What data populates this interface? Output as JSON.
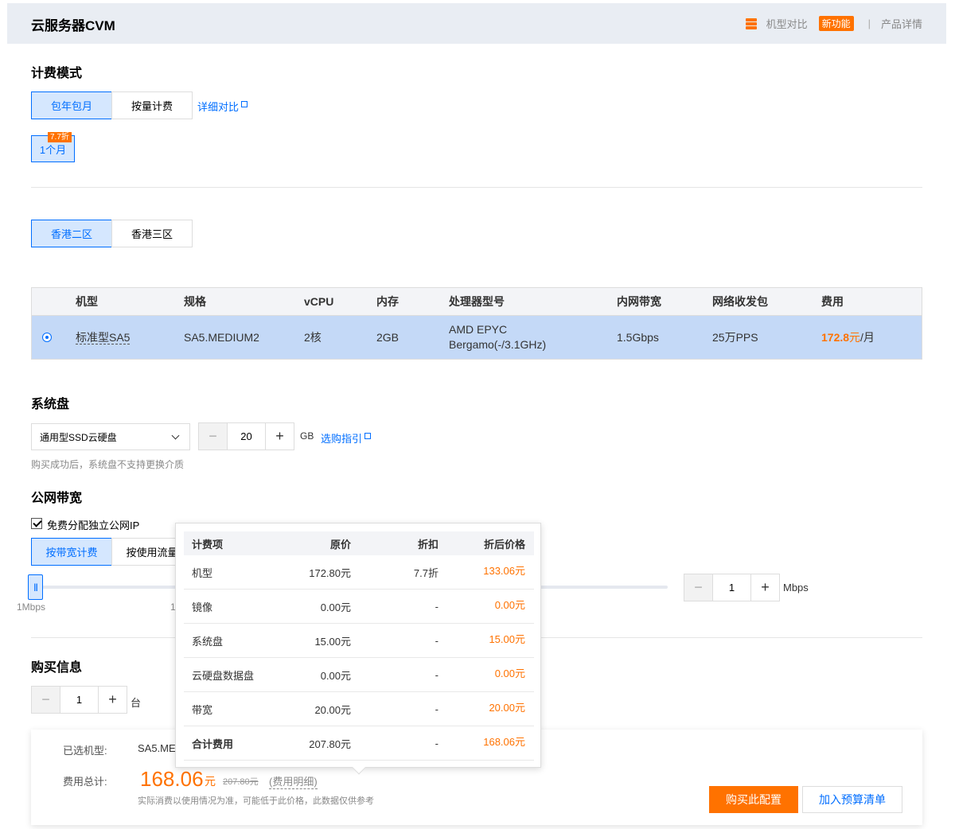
{
  "header": {
    "title": "云服务器CVM",
    "compare_label": "机型对比",
    "new_badge": "新功能",
    "separator": "|",
    "product_detail": "产品详情"
  },
  "billing": {
    "title": "计费模式",
    "options": [
      "包年包月",
      "按量计费"
    ],
    "selected": 0,
    "detail_link": "详细对比",
    "duration_discount": "7.7折",
    "duration": "1个月"
  },
  "zone": {
    "options": [
      "香港二区",
      "香港三区"
    ],
    "selected": 0
  },
  "instance_table": {
    "headers": [
      "机型",
      "规格",
      "vCPU",
      "内存",
      "处理器型号",
      "内网带宽",
      "网络收发包",
      "费用"
    ],
    "row": {
      "type": "标准型SA5",
      "spec": "SA5.MEDIUM2",
      "vcpu": "2核",
      "memory": "2GB",
      "cpu_model_line1": "AMD EPYC",
      "cpu_model_line2": "Bergamo(-/3.1GHz)",
      "bandwidth": "1.5Gbps",
      "pps": "25万PPS",
      "price": "172.8",
      "price_unit": "元",
      "price_period": "/月"
    }
  },
  "system_disk": {
    "title": "系统盘",
    "disk_type": "通用型SSD云硬盘",
    "size": "20",
    "unit": "GB",
    "guide_link": "选购指引",
    "hint": "购买成功后，系统盘不支持更换介质"
  },
  "network": {
    "title": "公网带宽",
    "free_ip_label": "免费分配独立公网IP",
    "billing_options": [
      "按带宽计费",
      "按使用流量"
    ],
    "selected": 0,
    "slider_min_label": "1Mbps",
    "slider_tick_label": "1",
    "bandwidth_value": "1",
    "bandwidth_unit": "Mbps"
  },
  "purchase": {
    "title": "购买信息",
    "quantity": "1",
    "quantity_unit": "台"
  },
  "footer": {
    "selected_label": "已选机型:",
    "selected_value": "SA5.ME",
    "total_label": "费用总计:",
    "total_price": "168.06",
    "total_unit": "元",
    "original_price": "207.80元",
    "detail_link": "(费用明细)",
    "note": "实际消费以使用情况为准，可能低于此价格，此数据仅供参考",
    "buy_button": "购买此配置",
    "budget_button": "加入预算清单"
  },
  "price_popover": {
    "headers": [
      "计费项",
      "原价",
      "折扣",
      "折后价格"
    ],
    "rows": [
      {
        "item": "机型",
        "original": "172.80元",
        "discount": "7.7折",
        "final": "133.06元"
      },
      {
        "item": "镜像",
        "original": "0.00元",
        "discount": "-",
        "final": "0.00元"
      },
      {
        "item": "系统盘",
        "original": "15.00元",
        "discount": "-",
        "final": "15.00元"
      },
      {
        "item": "云硬盘数据盘",
        "original": "0.00元",
        "discount": "-",
        "final": "0.00元"
      },
      {
        "item": "带宽",
        "original": "20.00元",
        "discount": "-",
        "final": "20.00元"
      },
      {
        "item": "合计费用",
        "original": "207.80元",
        "discount": "-",
        "final": "168.06元"
      }
    ]
  }
}
